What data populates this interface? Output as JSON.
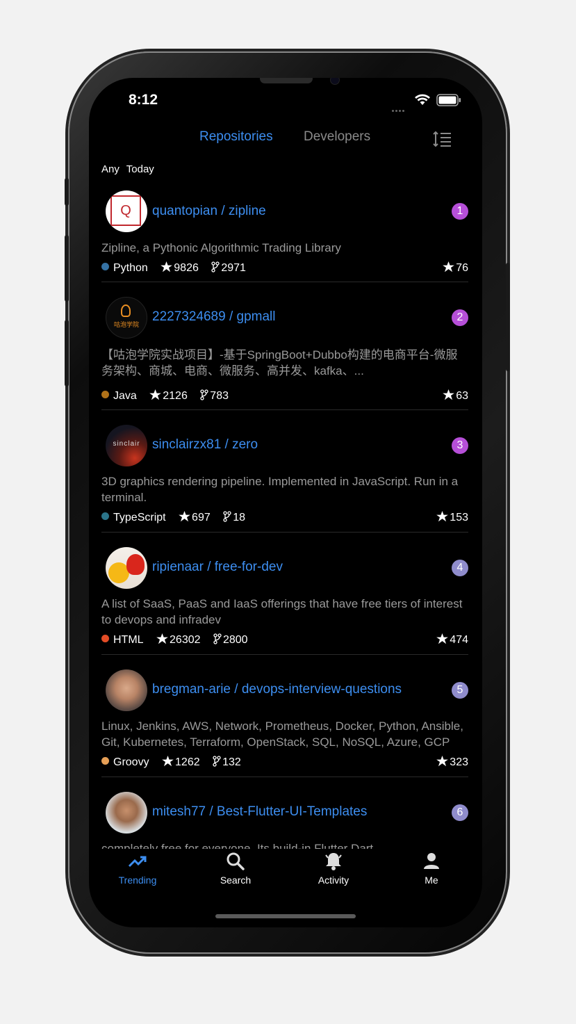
{
  "status_bar": {
    "time": "8:12"
  },
  "tabs": [
    {
      "label": "Repositories",
      "active": true
    },
    {
      "label": "Developers",
      "active": false
    }
  ],
  "filter": {
    "language": "Any",
    "period": "Today"
  },
  "repos": [
    {
      "rank": "1",
      "rank_color": "#b64fd8",
      "name": "quantopian / zipline",
      "description": "Zipline, a Pythonic Algorithmic Trading Library",
      "language": "Python",
      "lang_color": "#3572A5",
      "stars": "9826",
      "forks": "2971",
      "today": "76",
      "avatar_glyph": "Q"
    },
    {
      "rank": "2",
      "rank_color": "#b64fd8",
      "name": "2227324689 / gpmall",
      "description": "【咕泡学院实战项目】-基于SpringBoot+Dubbo构建的电商平台-微服务架构、商城、电商、微服务、高并发、kafka、...",
      "language": "Java",
      "lang_color": "#b07219",
      "stars": "2126",
      "forks": "783",
      "today": "63",
      "avatar_glyph": "咕泡学院"
    },
    {
      "rank": "3",
      "rank_color": "#b64fd8",
      "name": "sinclairzx81 / zero",
      "description": "3D graphics rendering pipeline. Implemented in JavaScript. Run in a terminal.",
      "language": "TypeScript",
      "lang_color": "#2b7489",
      "stars": "697",
      "forks": "18",
      "today": "153",
      "avatar_glyph": "sinclair"
    },
    {
      "rank": "4",
      "rank_color": "#8f8ccc",
      "name": "ripienaar / free-for-dev",
      "description": "A list of SaaS, PaaS and IaaS offerings that have free tiers of interest to devops and infradev",
      "language": "HTML",
      "lang_color": "#e34c26",
      "stars": "26302",
      "forks": "2800",
      "today": "474"
    },
    {
      "rank": "5",
      "rank_color": "#8f8ccc",
      "name": "bregman-arie / devops-interview-questions",
      "description": "Linux, Jenkins, AWS, Network, Prometheus, Docker, Python, Ansible, Git, Kubernetes, Terraform, OpenStack, SQL, NoSQL, Azure, GCP",
      "language": "Groovy",
      "lang_color": "#e69f56",
      "stars": "1262",
      "forks": "132",
      "today": "323"
    },
    {
      "rank": "6",
      "rank_color": "#8f8ccc",
      "name": "mitesh77 / Best-Flutter-UI-Templates",
      "description": "completely free for everyone. Its build-in Flutter Dart"
    }
  ],
  "bottom_nav": [
    {
      "label": "Trending",
      "icon": "trending-icon",
      "active": true
    },
    {
      "label": "Search",
      "icon": "search-icon",
      "active": false
    },
    {
      "label": "Activity",
      "icon": "bell-icon",
      "active": false
    },
    {
      "label": "Me",
      "icon": "person-icon",
      "active": false
    }
  ],
  "colors": {
    "accent": "#3d8ef0",
    "inactive": "#8a8a8a",
    "background": "#000000"
  }
}
